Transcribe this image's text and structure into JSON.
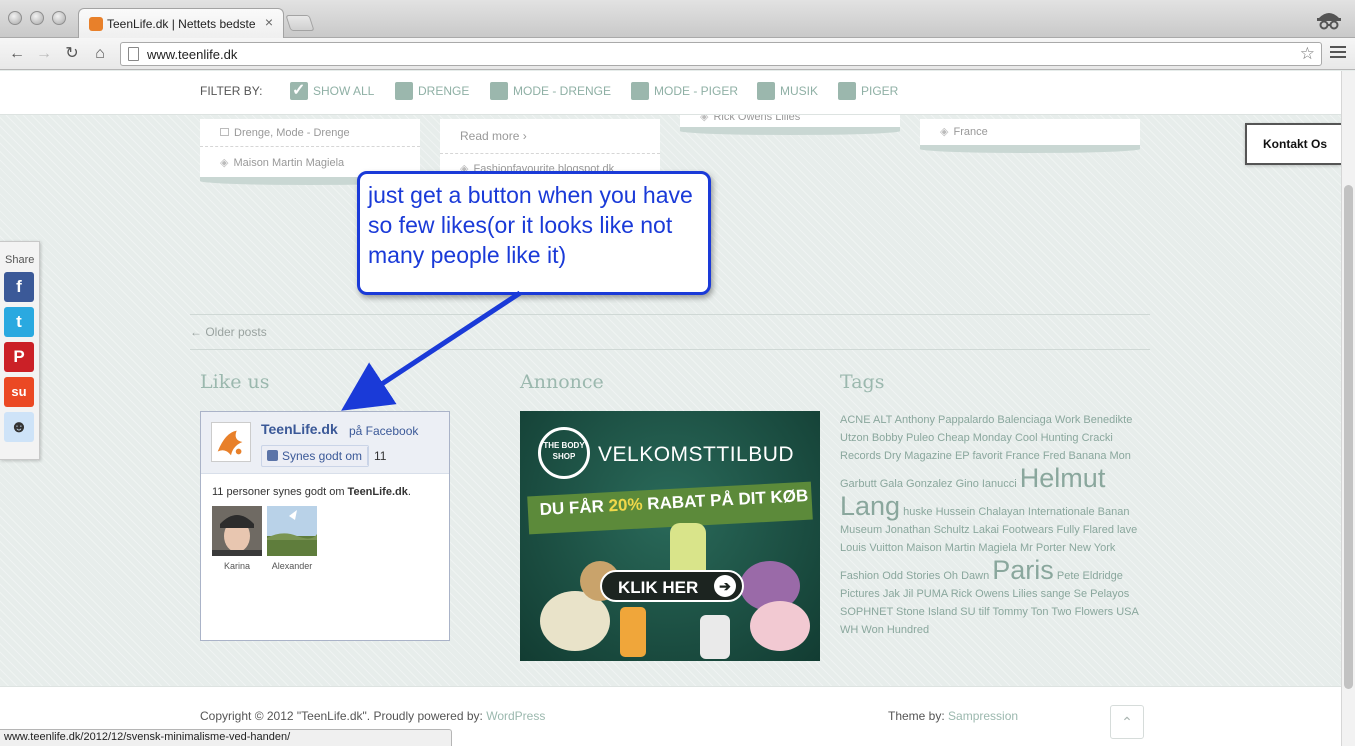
{
  "browser": {
    "tab_title": "TeenLife.dk | Nettets bedste",
    "tab_close": "×",
    "url": "www.teenlife.dk",
    "status_url": "www.teenlife.dk/2012/12/svensk-minimalisme-ved-handen/"
  },
  "filter": {
    "label": "FILTER BY:",
    "items": [
      {
        "label": "SHOW ALL",
        "checked": true
      },
      {
        "label": "DRENGE",
        "checked": false
      },
      {
        "label": "MODE - DRENGE",
        "checked": false
      },
      {
        "label": "MODE - PIGER",
        "checked": false
      },
      {
        "label": "MUSIK",
        "checked": false
      },
      {
        "label": "PIGER",
        "checked": false
      }
    ]
  },
  "posts": {
    "col1_category": "Drenge, Mode - Drenge",
    "col1_tag": "Maison Martin Magiela",
    "col2_readmore": "Read more ›",
    "col2_tag": "Fashionfavourite.blogspot.dk",
    "col3_tag": "Rick Owens Lilies",
    "col4_tag": "France"
  },
  "kontakt": "Kontakt Os",
  "share": {
    "label": "Share",
    "buttons": [
      {
        "icon": "facebook-icon",
        "glyph": "f",
        "color": "#3b5998"
      },
      {
        "icon": "twitter-icon",
        "glyph": "t",
        "color": "#2aa9e0"
      },
      {
        "icon": "pinterest-icon",
        "glyph": "P",
        "color": "#cb2027"
      },
      {
        "icon": "stumbleupon-icon",
        "glyph": "su",
        "color": "#eb4924"
      },
      {
        "icon": "reddit-icon",
        "glyph": "☻",
        "color": "#cee3f8"
      }
    ]
  },
  "annotation": {
    "text": "just get a button when you have so few likes(or it looks like not many people like it)"
  },
  "nav": {
    "older_posts": "← Older posts"
  },
  "sections": {
    "like_us": "Like us",
    "annonce": "Annonce",
    "tags": "Tags"
  },
  "facebook": {
    "page_name": "TeenLife.dk",
    "on_facebook": "på Facebook",
    "like_button": "Synes godt om",
    "like_count": "11",
    "likes_text_pre": "11 personer synes godt om ",
    "likes_text_name": "TeenLife.dk",
    "likes_text_post": ".",
    "faces": [
      {
        "name": "Karina"
      },
      {
        "name": "Alexander"
      }
    ]
  },
  "ad": {
    "logo": "THE BODY SHOP",
    "headline": "VELKOMSTTILBUD",
    "offer_pre": "DU FÅR ",
    "offer_pct": "20%",
    "offer_post": " RABAT PÅ DIT KØB",
    "cta": "KLIK HER",
    "cta_arrow": "➔"
  },
  "tags": [
    {
      "label": "ACNE",
      "big": false
    },
    {
      "label": "ALT",
      "big": false
    },
    {
      "label": "Anthony Pappalardo",
      "big": false
    },
    {
      "label": "Balenciaga",
      "big": false
    },
    {
      "label": "Work",
      "big": false
    },
    {
      "label": "Benedikte Utzon",
      "big": false
    },
    {
      "label": "Bobby Puleo",
      "big": false
    },
    {
      "label": "Cheap Monday",
      "big": false
    },
    {
      "label": "Cool Hunting",
      "big": false
    },
    {
      "label": "Cracki Records",
      "big": false
    },
    {
      "label": "Dry Magazine",
      "big": false
    },
    {
      "label": "EP",
      "big": false
    },
    {
      "label": "favorit",
      "big": false
    },
    {
      "label": "France",
      "big": false
    },
    {
      "label": "Fred Banana Mon Garbutt",
      "big": false
    },
    {
      "label": "Gala Gonzalez",
      "big": false
    },
    {
      "label": "Gino Ianucci",
      "big": false
    },
    {
      "label": "Helmut Lang",
      "big": true
    },
    {
      "label": "huske",
      "big": false
    },
    {
      "label": "Hussein Chalayan",
      "big": false
    },
    {
      "label": "Internationale",
      "big": false
    },
    {
      "label": "Banan Museum",
      "big": false
    },
    {
      "label": "Jonathan Schultz",
      "big": false
    },
    {
      "label": "Lakai Footwears",
      "big": false
    },
    {
      "label": "Fully Flared",
      "big": false
    },
    {
      "label": "lave",
      "big": false
    },
    {
      "label": "Louis Vuitton",
      "big": false
    },
    {
      "label": "Maison Martin Magiela",
      "big": false
    },
    {
      "label": "Mr Porter",
      "big": false
    },
    {
      "label": "New York Fashion",
      "big": false
    },
    {
      "label": "Odd Stories",
      "big": false
    },
    {
      "label": "Oh Dawn",
      "big": false
    },
    {
      "label": "Paris",
      "big": true
    },
    {
      "label": "Pete Eldridge Pictures",
      "big": false
    },
    {
      "label": "Jak Jil",
      "big": false
    },
    {
      "label": "PUMA",
      "big": false
    },
    {
      "label": "Rick Owens Lilies",
      "big": false
    },
    {
      "label": "sange",
      "big": false
    },
    {
      "label": "Se Pelayos",
      "big": false
    },
    {
      "label": "SOPHNET",
      "big": false
    },
    {
      "label": "Stone Island",
      "big": false
    },
    {
      "label": "SU",
      "big": false
    },
    {
      "label": "tilf",
      "big": false
    },
    {
      "label": "Tommy Ton",
      "big": false
    },
    {
      "label": "Two Flowers",
      "big": false
    },
    {
      "label": "USA",
      "big": false
    },
    {
      "label": "WH",
      "big": false
    },
    {
      "label": "Won Hundred",
      "big": false
    }
  ],
  "footer": {
    "copyright": "Copyright © 2012 \"TeenLife.dk\". Proudly powered by: ",
    "wordpress": "WordPress",
    "theme_by": "Theme by: ",
    "sampression": "Sampression",
    "to_top": "⌃"
  }
}
